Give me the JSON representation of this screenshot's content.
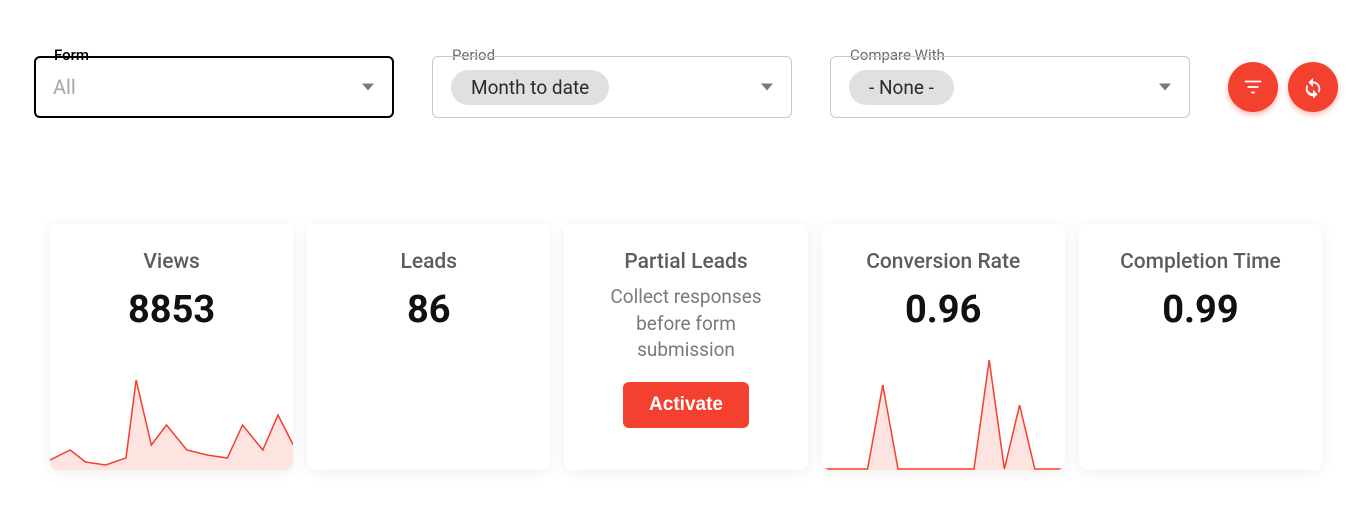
{
  "filters": {
    "form": {
      "label": "Form",
      "placeholder": "All"
    },
    "period": {
      "label": "Period",
      "value": "Month to date"
    },
    "compare": {
      "label": "Compare With",
      "value": "- None -"
    }
  },
  "cards": {
    "views": {
      "title": "Views",
      "value": "8853"
    },
    "leads": {
      "title": "Leads",
      "value": "86"
    },
    "partial": {
      "title": "Partial Leads",
      "desc": "Collect responses before form submission",
      "button": "Activate"
    },
    "conversion": {
      "title": "Conversion Rate",
      "value": "0.96"
    },
    "completion": {
      "title": "Completion Time",
      "value": "0.99"
    }
  },
  "colors": {
    "accent": "#f4402f"
  }
}
